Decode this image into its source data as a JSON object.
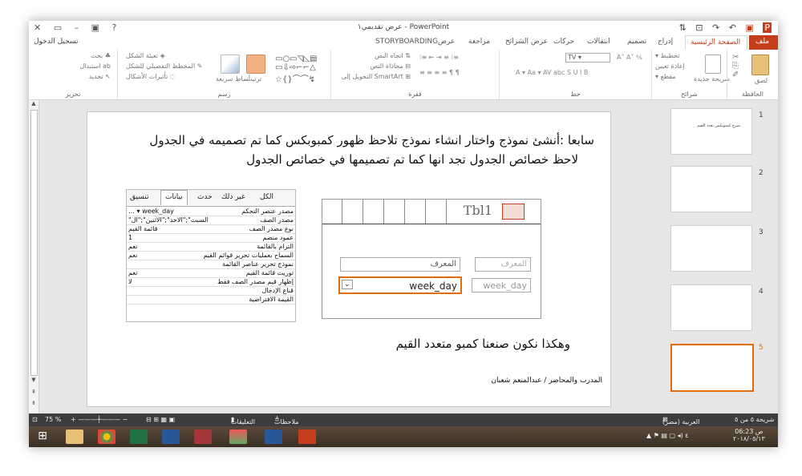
{
  "window": {
    "title": "عرض تقديمي١ - PowerPoint",
    "sign_in": "تسجيل الدخول"
  },
  "tabs": [
    "ملف",
    "الصفحة الرئيسية",
    "إدراج",
    "تصميم",
    "انتقالات",
    "حركات",
    "عرض الشرائح",
    "مراجعة",
    "عرض",
    "STORYBOARDING"
  ],
  "ribbon": {
    "groups": {
      "clipboard": "الحافظة",
      "slides": "شرائح",
      "font": "خط",
      "paragraph": "فقرة",
      "drawing": "رسم",
      "editing": "تحرير"
    },
    "clipboard": {
      "paste": "لصق"
    },
    "slides": {
      "new_slide": "شريحة جديدة",
      "layout": "تخطيط",
      "reset": "إعادة تعيين",
      "section": "مقطع"
    },
    "font": {
      "size": "TV"
    },
    "paragraph": {
      "text_direction": "اتجاه النص",
      "align_text": "محاذاة النص",
      "smartart": "التحويل إلى SmartArt"
    },
    "drawing": {
      "arrange": "ترتيب",
      "quick_styles": "أنماط سريعة",
      "fill": "تعبئة الشكل",
      "outline": "المخطط التفصيلي للشكل",
      "effects": "تأثيرات الأشكال"
    },
    "editing": {
      "find": "بحث",
      "replace": "استبدال",
      "select": "تحديد"
    }
  },
  "slide": {
    "line1": "سابعا :أنشئ نموذج واختار انشاء نموذج تلاحظ ظهور كمبوبكس كما تم تصميمه في الجدول",
    "line2": "لاحظ خصائص الجدول تجد انها كما تم تصميمها في خصائص الجدول",
    "line3": "وهكذا نكون صنعنا كمبو متعدد القيم",
    "footer": "المدرب والمحاضر / عبدالمنعم شعبان"
  },
  "property_sheet": {
    "tabs": [
      "تنسيق",
      "بيانات",
      "حدث",
      "غير ذلك",
      "الكل"
    ],
    "rows": [
      {
        "name": "مصدر عنصر التحكم",
        "value": "week_day"
      },
      {
        "name": "مصدر الصف",
        "value": "\"السبت\";\"الاحد\";\"الاثنين\";\"ال"
      },
      {
        "name": "نوع مصدر الصف",
        "value": "قائمة القيم"
      },
      {
        "name": "عمود منضم",
        "value": "1"
      },
      {
        "name": "التزام بالقائمة",
        "value": "نعم"
      },
      {
        "name": "السماح بعمليات تحرير قوائم القيم",
        "value": "نعم"
      },
      {
        "name": "نموذج تحرير عناصر القائمة",
        "value": ""
      },
      {
        "name": "توريث قائمة القيم",
        "value": "نعم"
      },
      {
        "name": "إظهار قيم مصدر الصف فقط",
        "value": "لا"
      },
      {
        "name": "قناع الإدخال",
        "value": ""
      },
      {
        "name": "القيمة الافتراضية",
        "value": ""
      }
    ]
  },
  "design": {
    "title": "Tbl1",
    "id_label": "المعرف",
    "id_field": "المعرف",
    "combo_label": "week_day",
    "combo_value": "week_day"
  },
  "thumbnails": {
    "numbers": [
      "1",
      "2",
      "3",
      "4",
      "5"
    ],
    "slide1_title": "شرح كمبوبكس تعدد القيم"
  },
  "status": {
    "slide_info": "شريحة ٥ من ٥",
    "language": "العربية (مصر)",
    "notes": "ملاحظات",
    "comments": "التعليقات",
    "zoom": "75 %"
  },
  "taskbar": {
    "time": "06:23 ص",
    "date": "٢٠١٨/٠٥/١٣"
  },
  "colors": {
    "accent": "#c43e1c",
    "selection": "#e46c0a"
  }
}
